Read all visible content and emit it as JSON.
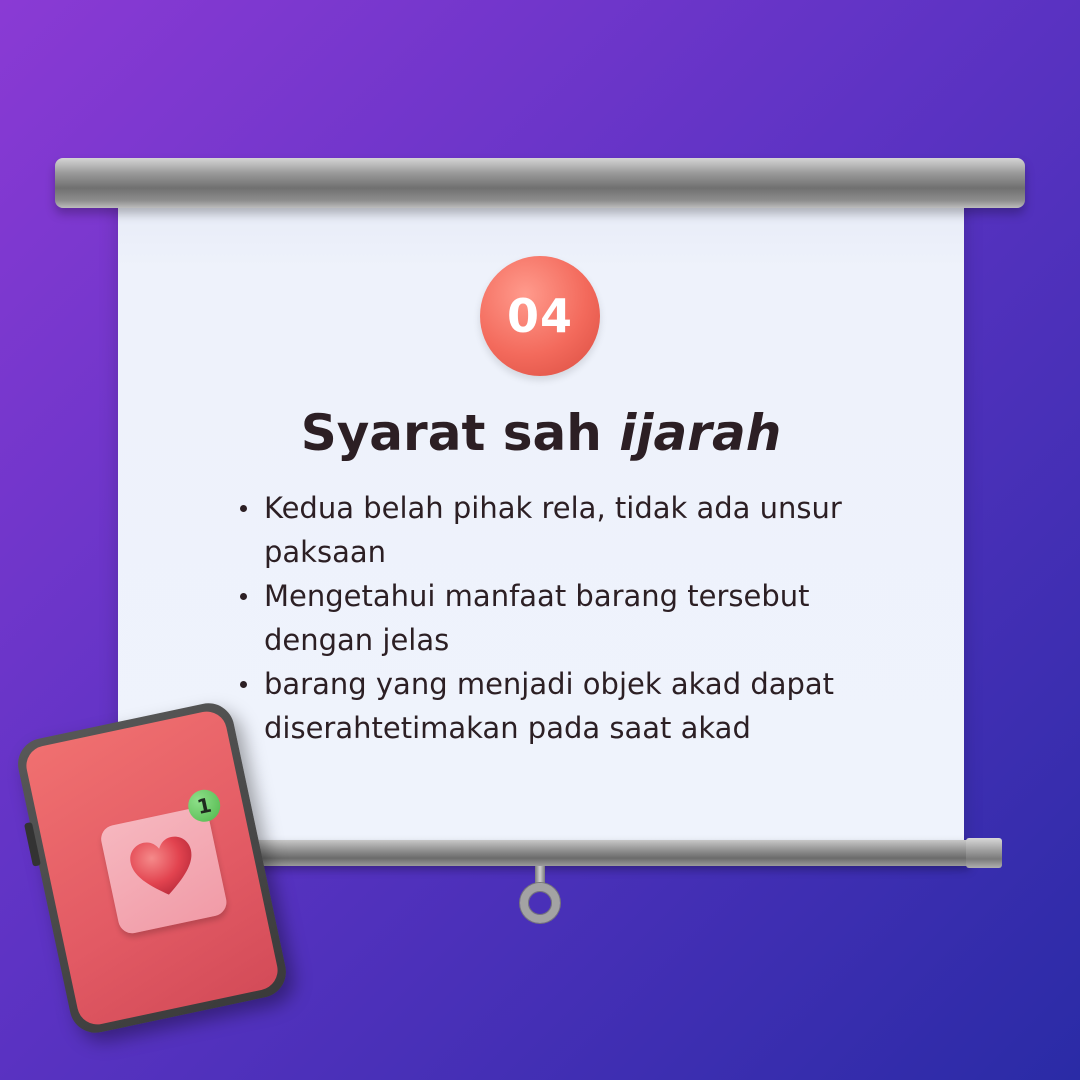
{
  "slide": {
    "number": "04",
    "title": "Syarat sah",
    "title_emphasis": "ijarah",
    "items": [
      "Kedua belah pihak rela, tidak ada unsur paksaan",
      "Mengetahui manfaat barang tersebut dengan jelas",
      "barang yang menjadi objek akad dapat diserahtetimakan pada saat akad"
    ]
  },
  "phone": {
    "notification_count": "1",
    "icon": "heart-icon"
  },
  "colors": {
    "background_start": "#8a3ad4",
    "background_end": "#2a2ba6",
    "badge": "#f36a5c",
    "text": "#2c1f24",
    "phone": "#e25a64",
    "notification": "#4fb64a"
  }
}
